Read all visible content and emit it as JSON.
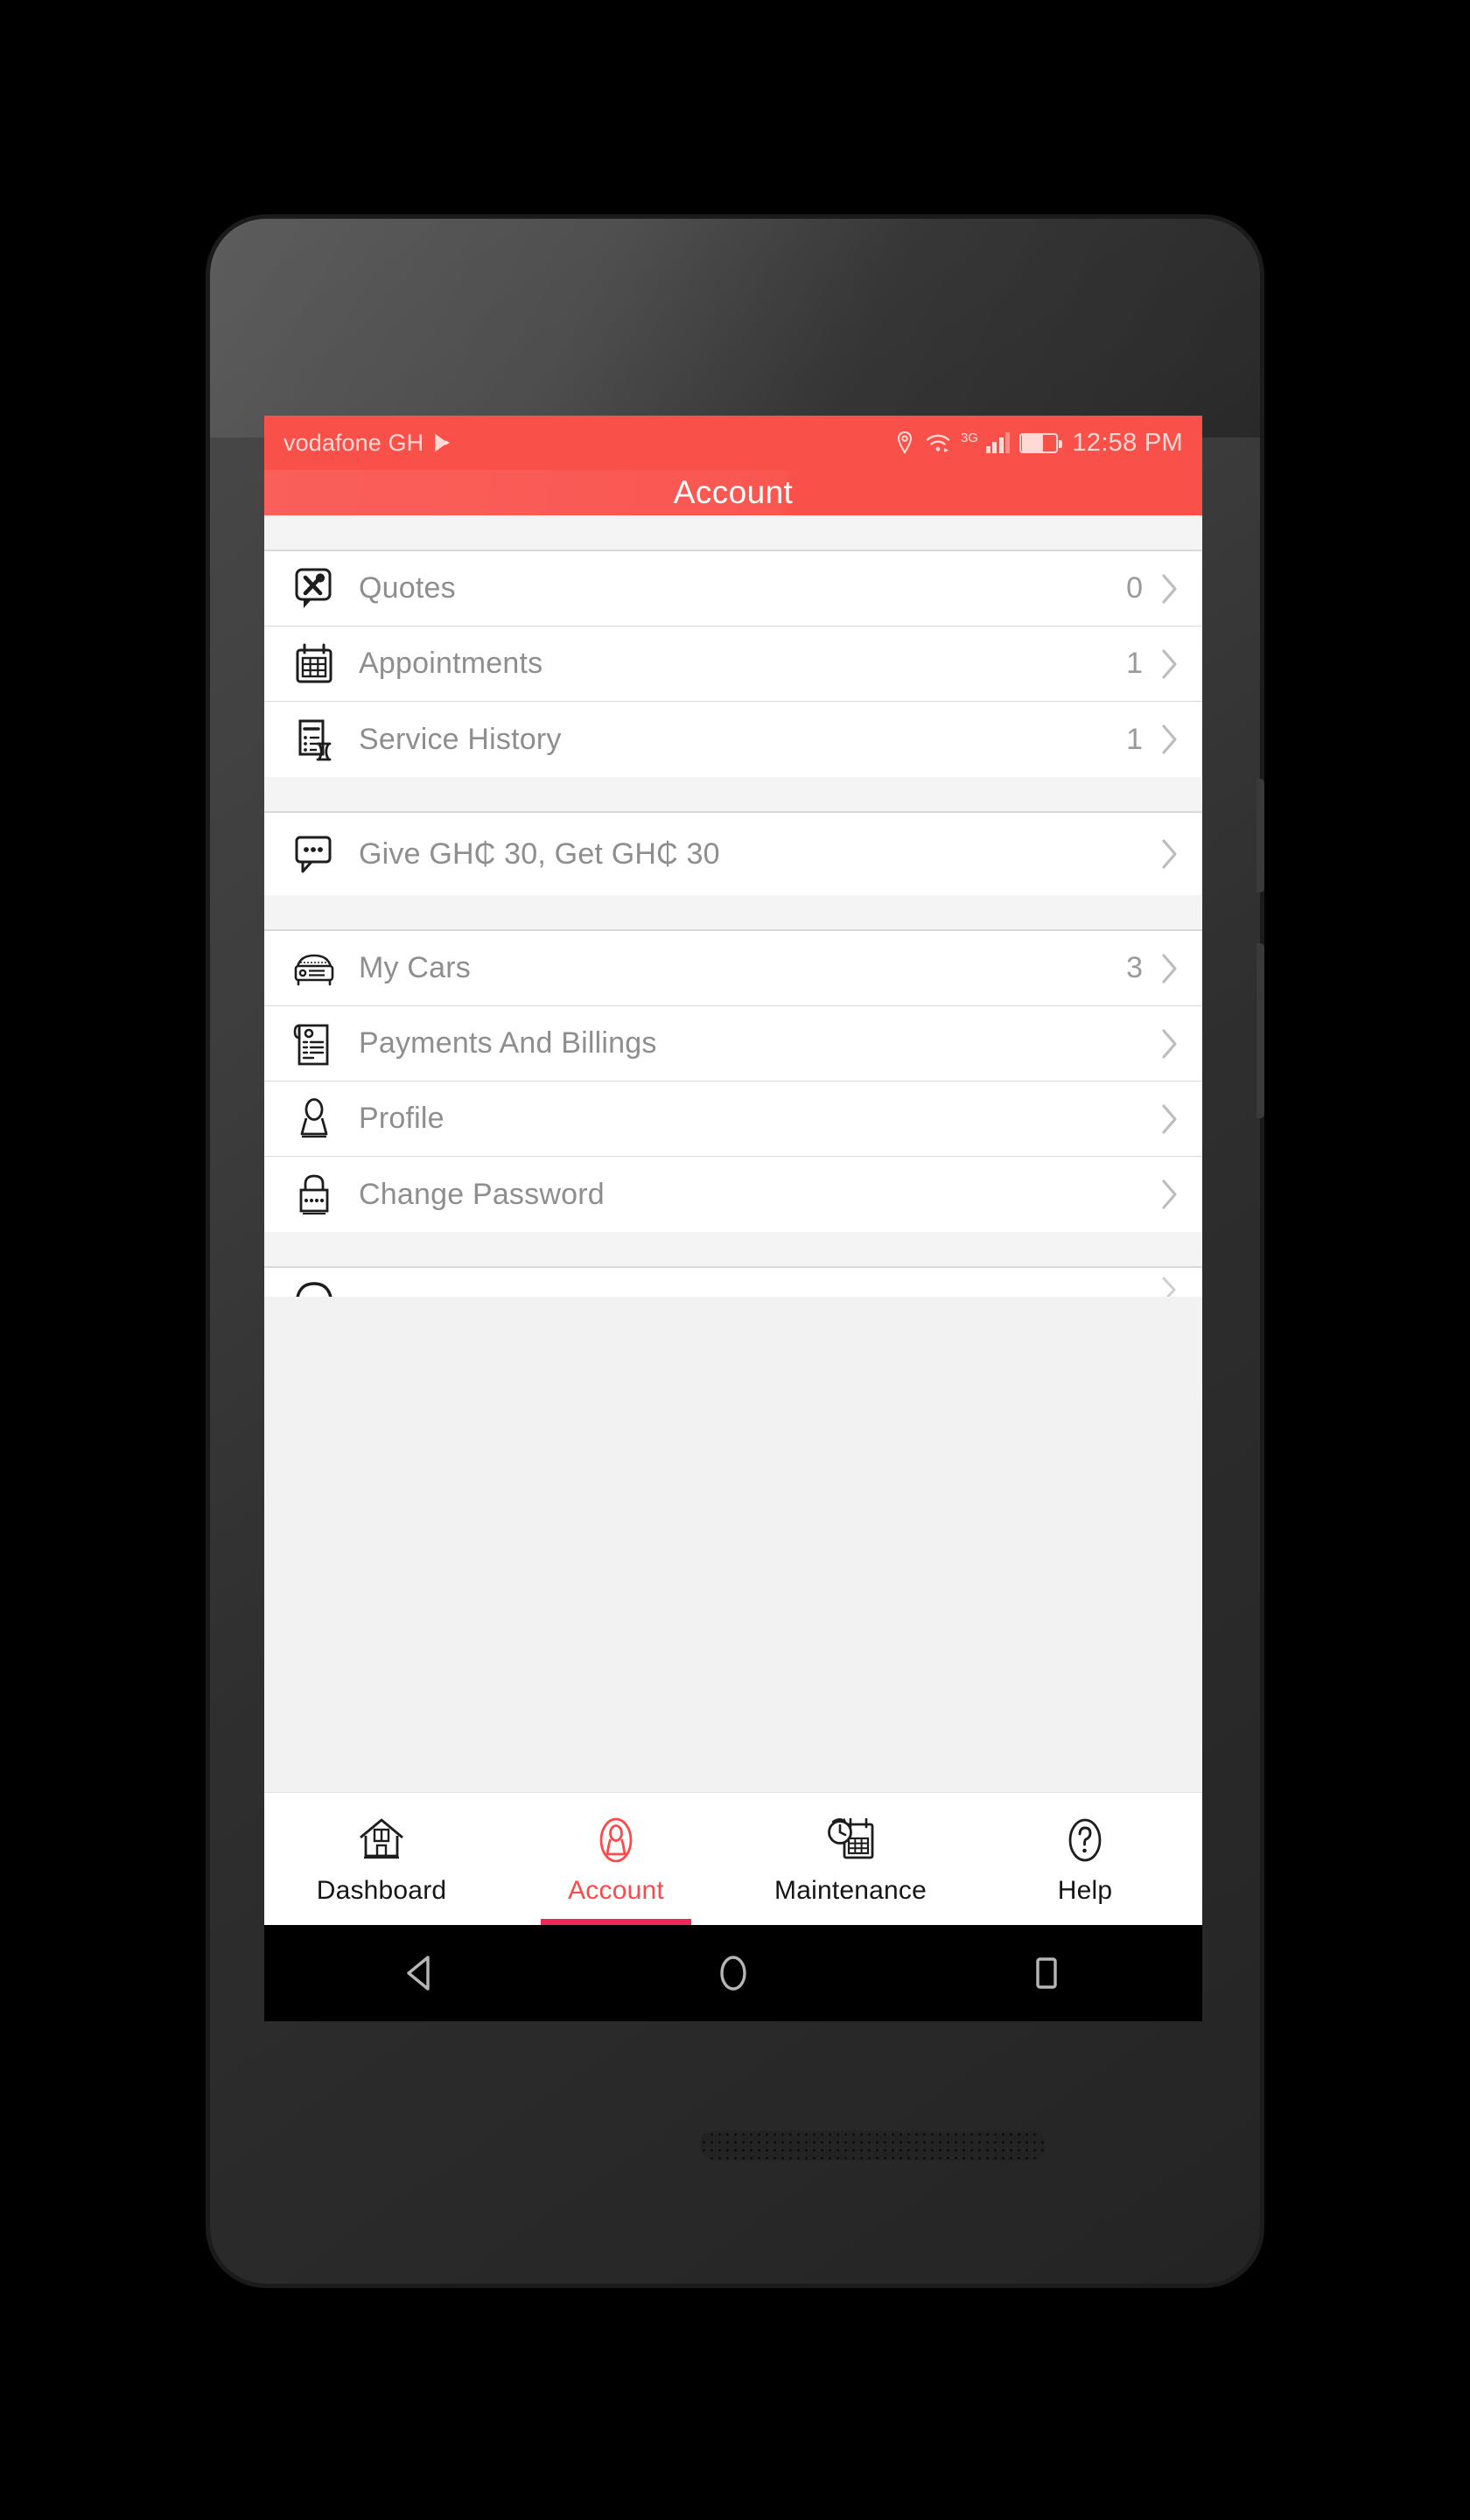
{
  "status_bar": {
    "carrier": "vodafone GH",
    "playstore_icon": "play-store-icon",
    "location_icon": "location-pin-icon",
    "wifi_icon": "wifi-icon",
    "network_type": "3G",
    "signal_icon": "signal-bars-icon",
    "battery_icon": "battery-icon",
    "time": "12:58 PM"
  },
  "app_bar": {
    "title": "Account",
    "background_color": "#FA504A"
  },
  "groups": [
    {
      "rows": [
        {
          "icon": "quotes-tools-bubble-icon",
          "label": "Quotes",
          "count": "0",
          "chevron": "chevron-right-icon"
        },
        {
          "icon": "calendar-icon",
          "label": "Appointments",
          "count": "1",
          "chevron": "chevron-right-icon"
        },
        {
          "icon": "service-history-hourglass-icon",
          "label": "Service History",
          "count": "1",
          "chevron": "chevron-right-icon"
        }
      ]
    },
    {
      "rows": [
        {
          "icon": "chat-bubble-dots-icon",
          "label": "Give GH₵ 30, Get GH₵ 30",
          "count": "",
          "chevron": "chevron-right-icon"
        }
      ]
    },
    {
      "rows": [
        {
          "icon": "car-front-icon",
          "label": "My Cars",
          "count": "3",
          "chevron": "chevron-right-icon"
        },
        {
          "icon": "invoice-receipt-icon",
          "label": "Payments And Billings",
          "count": "",
          "chevron": "chevron-right-icon"
        },
        {
          "icon": "person-profile-icon",
          "label": "Profile",
          "count": "",
          "chevron": "chevron-right-icon"
        },
        {
          "icon": "padlock-icon",
          "label": "Change Password",
          "count": "",
          "chevron": "chevron-right-icon"
        }
      ]
    }
  ],
  "tab_bar": {
    "active_color": "#FB4A4A",
    "indicator_color": "#F0285A",
    "items": [
      {
        "icon": "home-house-icon",
        "label": "Dashboard",
        "active": false
      },
      {
        "icon": "person-account-icon",
        "label": "Account",
        "active": true
      },
      {
        "icon": "maintenance-clock-calendar-icon",
        "label": "Maintenance",
        "active": false
      },
      {
        "icon": "help-question-mark-icon",
        "label": "Help",
        "active": false
      }
    ]
  },
  "android_nav": {
    "back": "back-triangle-icon",
    "home": "home-circle-icon",
    "recents": "recents-square-icon"
  }
}
